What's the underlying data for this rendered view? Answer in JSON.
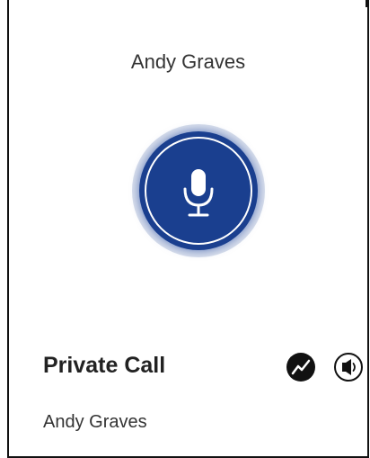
{
  "call": {
    "caller_name": "Andy Graves",
    "type_label": "Private Call",
    "participant_name": "Andy Graves"
  },
  "icons": {
    "ptt": "microphone-icon",
    "signal": "signal-trend-icon",
    "speaker": "speaker-icon"
  },
  "colors": {
    "ptt_button": "#1a3f8f",
    "icon_dark": "#111111",
    "text": "#222222"
  }
}
